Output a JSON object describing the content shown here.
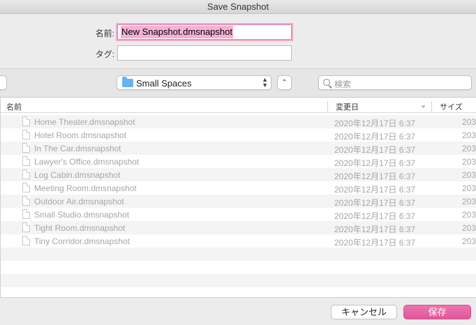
{
  "window": {
    "title": "Save Snapshot"
  },
  "form": {
    "name_label": "名前:",
    "name_value": "New Snapshot.dmsnapshot",
    "tags_label": "タグ:",
    "tags_value": ""
  },
  "toolbar": {
    "location": "Small Spaces",
    "search_placeholder": "検索"
  },
  "columns": {
    "name": "名前",
    "date": "変更日",
    "size": "サイズ"
  },
  "files": [
    {
      "name": "Home Theater.dmsnapshot",
      "date": "2020年12月17日 6:37",
      "size": "203"
    },
    {
      "name": "Hotel Room.dmsnapshot",
      "date": "2020年12月17日 6:37",
      "size": "203"
    },
    {
      "name": "In The Car.dmsnapshot",
      "date": "2020年12月17日 6:37",
      "size": "203"
    },
    {
      "name": "Lawyer's Office.dmsnapshot",
      "date": "2020年12月17日 6:37",
      "size": "203"
    },
    {
      "name": "Log Cabin.dmsnapshot",
      "date": "2020年12月17日 6:37",
      "size": "203"
    },
    {
      "name": "Meeting Room.dmsnapshot",
      "date": "2020年12月17日 6:37",
      "size": "203"
    },
    {
      "name": "Outdoor Air.dmsnapshot",
      "date": "2020年12月17日 6:37",
      "size": "203"
    },
    {
      "name": "Small Studio.dmsnapshot",
      "date": "2020年12月17日 6:37",
      "size": "203"
    },
    {
      "name": "Tight Room.dmsnapshot",
      "date": "2020年12月17日 6:37",
      "size": "203"
    },
    {
      "name": "Tiny Corridor.dmsnapshot",
      "date": "2020年12月17日 6:37",
      "size": "203"
    }
  ],
  "footer": {
    "cancel_label": "キャンセル",
    "save_label": "保存"
  },
  "icons": {
    "folder": "folder-icon",
    "search": "search-icon",
    "file": "file-icon",
    "sort": "chevron-down-icon",
    "updown": "up-down-arrows-icon",
    "up": "chevron-up-icon"
  },
  "colors": {
    "accent": "#e0589a",
    "selection": "#f5b1d3",
    "folder": "#69b3ef"
  }
}
